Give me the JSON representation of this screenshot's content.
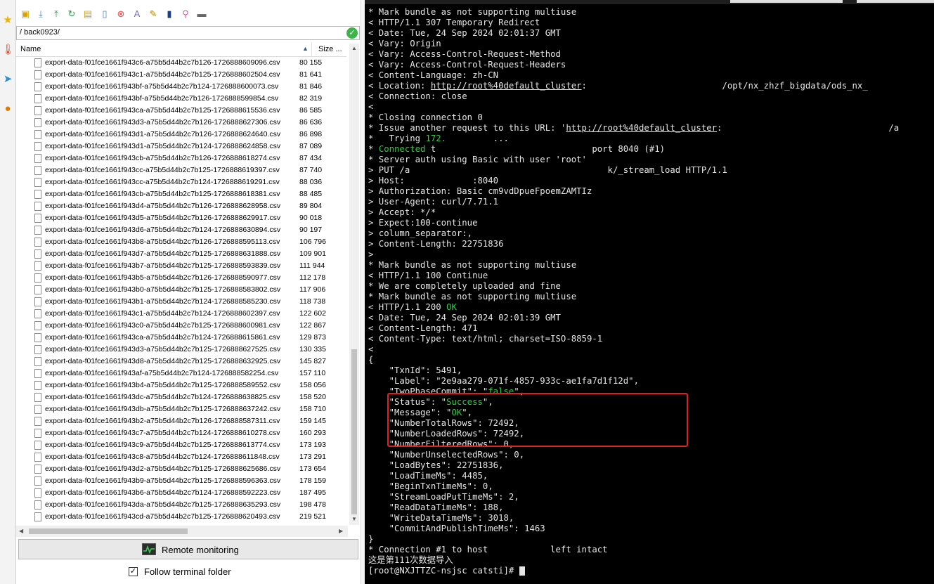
{
  "left_strip": {
    "icons": [
      "star-icon",
      "thermometer-icon",
      "send-icon",
      "globe-icon"
    ]
  },
  "sftp": {
    "toolbar_icons": [
      "upload-folder-icon",
      "download-icon",
      "upload-icon",
      "refresh-icon",
      "new-folder-icon",
      "new-file-icon",
      "delete-icon",
      "rename-icon",
      "properties-icon",
      "remote-file-icon",
      "tools-icon",
      "terminal-icon"
    ],
    "path": "/ back0923/",
    "columns": {
      "name": "Name",
      "size": "Size ..."
    },
    "files": [
      {
        "name": "export-data-f01fce1661f943c6-a75b5d44b2c7b126-1726888609096.csv",
        "size": "80 155"
      },
      {
        "name": "export-data-f01fce1661f943c1-a75b5d44b2c7b125-1726888602504.csv",
        "size": "81 641"
      },
      {
        "name": "export-data-f01fce1661f943bf-a75b5d44b2c7b124-1726888600073.csv",
        "size": "81 846"
      },
      {
        "name": "export-data-f01fce1661f943bf-a75b5d44b2c7b126-1726888599854.csv",
        "size": "82 319"
      },
      {
        "name": "export-data-f01fce1661f943ca-a75b5d44b2c7b125-1726888615536.csv",
        "size": "86 585"
      },
      {
        "name": "export-data-f01fce1661f943d3-a75b5d44b2c7b126-1726888627306.csv",
        "size": "86 636"
      },
      {
        "name": "export-data-f01fce1661f943d1-a75b5d44b2c7b126-1726888624640.csv",
        "size": "86 898"
      },
      {
        "name": "export-data-f01fce1661f943d1-a75b5d44b2c7b124-1726888624858.csv",
        "size": "87 089"
      },
      {
        "name": "export-data-f01fce1661f943cb-a75b5d44b2c7b126-1726888618274.csv",
        "size": "87 434"
      },
      {
        "name": "export-data-f01fce1661f943cc-a75b5d44b2c7b125-1726888619397.csv",
        "size": "87 740"
      },
      {
        "name": "export-data-f01fce1661f943cc-a75b5d44b2c7b124-1726888619291.csv",
        "size": "88 036"
      },
      {
        "name": "export-data-f01fce1661f943cb-a75b5d44b2c7b125-1726888618381.csv",
        "size": "88 485"
      },
      {
        "name": "export-data-f01fce1661f943d4-a75b5d44b2c7b126-1726888628958.csv",
        "size": "89 804"
      },
      {
        "name": "export-data-f01fce1661f943d5-a75b5d44b2c7b126-1726888629917.csv",
        "size": "90 018"
      },
      {
        "name": "export-data-f01fce1661f943d6-a75b5d44b2c7b124-1726888630894.csv",
        "size": "90 197"
      },
      {
        "name": "export-data-f01fce1661f943b8-a75b5d44b2c7b126-1726888595113.csv",
        "size": "106 796"
      },
      {
        "name": "export-data-f01fce1661f943d7-a75b5d44b2c7b125-1726888631888.csv",
        "size": "109 901"
      },
      {
        "name": "export-data-f01fce1661f943b7-a75b5d44b2c7b125-1726888593839.csv",
        "size": "111 944"
      },
      {
        "name": "export-data-f01fce1661f943b5-a75b5d44b2c7b126-1726888590977.csv",
        "size": "112 178"
      },
      {
        "name": "export-data-f01fce1661f943b0-a75b5d44b2c7b125-1726888583802.csv",
        "size": "117 906"
      },
      {
        "name": "export-data-f01fce1661f943b1-a75b5d44b2c7b124-1726888585230.csv",
        "size": "118 738"
      },
      {
        "name": "export-data-f01fce1661f943c1-a75b5d44b2c7b124-1726888602397.csv",
        "size": "122 602"
      },
      {
        "name": "export-data-f01fce1661f943c0-a75b5d44b2c7b125-1726888600981.csv",
        "size": "122 867"
      },
      {
        "name": "export-data-f01fce1661f943ca-a75b5d44b2c7b124-1726888615861.csv",
        "size": "129 873"
      },
      {
        "name": "export-data-f01fce1661f943d3-a75b5d44b2c7b125-1726888627525.csv",
        "size": "130 335"
      },
      {
        "name": "export-data-f01fce1661f943d8-a75b5d44b2c7b125-1726888632925.csv",
        "size": "145 827"
      },
      {
        "name": "export-data-f01fce1661f943af-a75b5d44b2c7b124-1726888582254.csv",
        "size": "157 110"
      },
      {
        "name": "export-data-f01fce1661f943b4-a75b5d44b2c7b125-1726888589552.csv",
        "size": "158 056"
      },
      {
        "name": "export-data-f01fce1661f943dc-a75b5d44b2c7b124-1726888638825.csv",
        "size": "158 520"
      },
      {
        "name": "export-data-f01fce1661f943db-a75b5d44b2c7b125-1726888637242.csv",
        "size": "158 710"
      },
      {
        "name": "export-data-f01fce1661f943b2-a75b5d44b2c7b126-1726888587311.csv",
        "size": "159 145"
      },
      {
        "name": "export-data-f01fce1661f943c7-a75b5d44b2c7b124-1726888610278.csv",
        "size": "160 293"
      },
      {
        "name": "export-data-f01fce1661f943c9-a75b5d44b2c7b125-1726888613774.csv",
        "size": "173 193"
      },
      {
        "name": "export-data-f01fce1661f943c8-a75b5d44b2c7b124-1726888611848.csv",
        "size": "173 291"
      },
      {
        "name": "export-data-f01fce1661f943d2-a75b5d44b2c7b125-1726888625686.csv",
        "size": "173 654"
      },
      {
        "name": "export-data-f01fce1661f943b9-a75b5d44b2c7b125-1726888596363.csv",
        "size": "178 159"
      },
      {
        "name": "export-data-f01fce1661f943b6-a75b5d44b2c7b124-1726888592223.csv",
        "size": "187 495"
      },
      {
        "name": "export-data-f01fce1661f943da-a75b5d44b2c7b125-1726888635293.csv",
        "size": "198 478"
      },
      {
        "name": "export-data-f01fce1661f943cd-a75b5d44b2c7b125-1726888620493.csv",
        "size": "219 521"
      }
    ],
    "remote_monitoring_label": "Remote monitoring",
    "follow_label": "Follow terminal folder",
    "follow_checked": "✓"
  },
  "terminal": {
    "colors": {
      "background": "#000000",
      "text": "#e6e6e6",
      "green": "#2ecc40",
      "highlight_box": "#e02020"
    },
    "lines": [
      [
        {
          "t": "* Mark bundle as not supporting multiuse"
        }
      ],
      [
        {
          "t": "< HTTP/1.1 307 Temporary Redirect"
        }
      ],
      [
        {
          "t": "< Date: Tue, 24 Sep 2024 02:01:37 GMT"
        }
      ],
      [
        {
          "t": "< Vary: Origin"
        }
      ],
      [
        {
          "t": "< Vary: Access-Control-Request-Method"
        }
      ],
      [
        {
          "t": "< Vary: Access-Control-Request-Headers"
        }
      ],
      [
        {
          "t": "< Content-Language: zh-CN"
        }
      ],
      [
        {
          "t": "< Location: "
        },
        {
          "t": "http://root%40default_cluster",
          "s": "u"
        },
        {
          "t": ":                          /opt/nx_zhzf_bigdata/ods_nx_"
        }
      ],
      [
        {
          "t": "< Connection: close"
        }
      ],
      [
        {
          "t": "<"
        }
      ],
      [
        {
          "t": "* Closing connection 0"
        }
      ],
      [
        {
          "t": "* Issue another request to this URL: '"
        },
        {
          "t": "http://root%40default_cluster",
          "s": "u"
        },
        {
          "t": ":                                /a"
        }
      ],
      [
        {
          "t": "*   Trying "
        },
        {
          "t": "172.",
          "s": "g"
        },
        {
          "t": "         ..."
        }
      ],
      [
        {
          "t": "* "
        },
        {
          "t": "Connected",
          "s": "g"
        },
        {
          "t": " t                              port 8040 (#1)"
        }
      ],
      [
        {
          "t": "* Server auth using Basic with user 'root'"
        }
      ],
      [
        {
          "t": "> PUT /a                                      k/_stream_load HTTP/1.1"
        }
      ],
      [
        {
          "t": "> Host:             :8040"
        }
      ],
      [
        {
          "t": "> Authorization: Basic cm9vdDpueFpoemZAMTIz"
        }
      ],
      [
        {
          "t": "> User-Agent: curl/7.71.1"
        }
      ],
      [
        {
          "t": "> Accept: */*"
        }
      ],
      [
        {
          "t": "> Expect:100-continue"
        }
      ],
      [
        {
          "t": "> column_separator:,"
        }
      ],
      [
        {
          "t": "> Content-Length: 22751836"
        }
      ],
      [
        {
          "t": ">"
        }
      ],
      [
        {
          "t": "* Mark bundle as not supporting multiuse"
        }
      ],
      [
        {
          "t": "< HTTP/1.1 100 Continue"
        }
      ],
      [
        {
          "t": "* We are completely uploaded and fine"
        }
      ],
      [
        {
          "t": "* Mark bundle as not supporting multiuse"
        }
      ],
      [
        {
          "t": "< HTTP/1.1 200 "
        },
        {
          "t": "OK",
          "s": "g"
        }
      ],
      [
        {
          "t": "< Date: Tue, 24 Sep 2024 02:01:39 GMT"
        }
      ],
      [
        {
          "t": "< Content-Length: 471"
        }
      ],
      [
        {
          "t": "< Content-Type: text/html; charset=ISO-8859-1"
        }
      ],
      [
        {
          "t": "<"
        }
      ],
      [
        {
          "t": "{"
        }
      ],
      [
        {
          "t": "    \"TxnId\": 5491,"
        }
      ],
      [
        {
          "t": "    \"Label\": \"2e9aa279-071f-4857-933c-ae1fa7d1f12d\","
        }
      ],
      [
        {
          "t": "    \"TwoPhaseCommit\": \""
        },
        {
          "t": "false",
          "s": "g"
        },
        {
          "t": "\","
        }
      ],
      [
        {
          "t": "    \"Status\": \""
        },
        {
          "t": "Success",
          "s": "g"
        },
        {
          "t": "\","
        }
      ],
      [
        {
          "t": "    \"Message\": \""
        },
        {
          "t": "OK",
          "s": "g"
        },
        {
          "t": "\","
        }
      ],
      [
        {
          "t": "    \"NumberTotalRows\": 72492,"
        }
      ],
      [
        {
          "t": "    \"NumberLoadedRows\": 72492,"
        }
      ],
      [
        {
          "t": "    \"NumberFilteredRows\": 0,"
        }
      ],
      [
        {
          "t": "    \"NumberUnselectedRows\": 0,"
        }
      ],
      [
        {
          "t": "    \"LoadBytes\": 22751836,"
        }
      ],
      [
        {
          "t": "    \"LoadTimeMs\": 4485,"
        }
      ],
      [
        {
          "t": "    \"BeginTxnTimeMs\": 0,"
        }
      ],
      [
        {
          "t": "    \"StreamLoadPutTimeMs\": 2,"
        }
      ],
      [
        {
          "t": "    \"ReadDataTimeMs\": 188,"
        }
      ],
      [
        {
          "t": "    \"WriteDataTimeMs\": 3018,"
        }
      ],
      [
        {
          "t": "    \"CommitAndPublishTimeMs\": 1463"
        }
      ],
      [
        {
          "t": "}"
        }
      ],
      [
        {
          "t": "* Connection #1 to host            left intact"
        }
      ],
      [
        {
          "t": "这是第111次数据导入"
        }
      ],
      [
        {
          "t": "[root@NXJTTZC-nsjsc catsti]# "
        }
      ]
    ]
  }
}
